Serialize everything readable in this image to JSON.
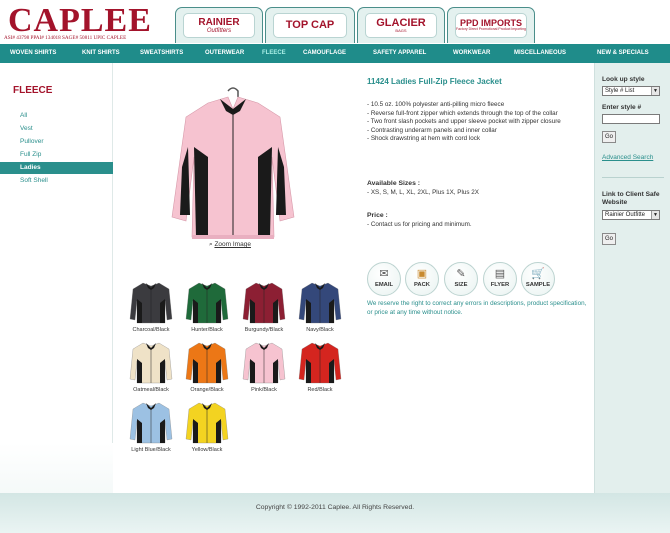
{
  "header": {
    "logo": "CAPLEE",
    "codes": "ASI# 43798  PPAI# 134018  SAGE# 50811  UPIC CAPLEE",
    "brands": [
      {
        "name": "RAINIER",
        "sub": "Outfitters"
      },
      {
        "name": "TOP CAP",
        "sub": ""
      },
      {
        "name": "GLACIER",
        "sub": "BAGS"
      },
      {
        "name": "PPD IMPORTS",
        "sub": "Factory Direct Promotional Product Importing"
      }
    ]
  },
  "nav": {
    "items": [
      "WOVEN SHIRTS",
      "KNIT SHIRTS",
      "SWEATSHIRTS",
      "OUTERWEAR",
      "FLEECE",
      "CAMOUFLAGE",
      "SAFETY APPAREL",
      "WORKWEAR",
      "MISCELLANEOUS",
      "NEW & SPECIALS"
    ],
    "active": "FLEECE"
  },
  "sidebar": {
    "title": "FLEECE",
    "items": [
      "All",
      "Vest",
      "Pullover",
      "Full Zip",
      "Ladies",
      "Soft Shell"
    ],
    "active": "Ladies"
  },
  "product": {
    "title": "11424  Ladies Full-Zip Fleece Jacket",
    "features": [
      "- 10.5 oz. 100% polyester anti-pilling micro fleece",
      "- Reverse full-front zipper which extends through the top of the collar",
      "- Two front slash pockets and upper sleeve pocket with zipper closure",
      "- Contrasting underarm panels and inner collar",
      "- Shock drawstring at hem with cord lock"
    ],
    "sizes_heading": "Available Sizes :",
    "sizes": "- XS, S, M, L, XL, 2XL, Plus 1X, Plus 2X",
    "price_heading": "Price :",
    "price": "- Contact us for pricing and minimum.",
    "zoom_label": "Zoom Image",
    "main_color": "#f6c3d0",
    "actions": [
      {
        "label": "EMAIL",
        "icon": "email-icon",
        "glyph": "✉"
      },
      {
        "label": "PACK",
        "icon": "box-icon",
        "glyph": "▣"
      },
      {
        "label": "SIZE",
        "icon": "ruler-icon",
        "glyph": "✎"
      },
      {
        "label": "FLYER",
        "icon": "document-icon",
        "glyph": "▤"
      },
      {
        "label": "SAMPLE",
        "icon": "cart-icon",
        "glyph": "🛒"
      }
    ],
    "disclaimer": "We reserve the right to correct any errors in descriptions, product specification, or price at any time without notice."
  },
  "swatches": [
    {
      "label": "Charcoal/Black",
      "color": "#3b3b3f"
    },
    {
      "label": "Hunter/Black",
      "color": "#1f6a3a"
    },
    {
      "label": "Burgundy/Black",
      "color": "#8c1f33"
    },
    {
      "label": "Navy/Black",
      "color": "#34487a"
    },
    {
      "label": "Oatmeal/Black",
      "color": "#efe2c7"
    },
    {
      "label": "Orange/Black",
      "color": "#ec7716"
    },
    {
      "label": "Pink/Black",
      "color": "#f6c3d0"
    },
    {
      "label": "Red/Black",
      "color": "#d4251f"
    },
    {
      "label": "Light Blue/Black",
      "color": "#9cc1e3"
    },
    {
      "label": "Yellow/Black",
      "color": "#f3d321"
    }
  ],
  "right": {
    "lookup_label": "Look up style",
    "lookup_select": "Style # List",
    "enter_label": "Enter style #",
    "go": "Go",
    "advanced": "Advanced Search",
    "link_label": "Link to Client Safe Website",
    "link_select": "Rainier Outfitte",
    "go2": "Go"
  },
  "footer": {
    "copyright": "Copyright © 1992-2011 Caplee. All Rights Reserved."
  }
}
